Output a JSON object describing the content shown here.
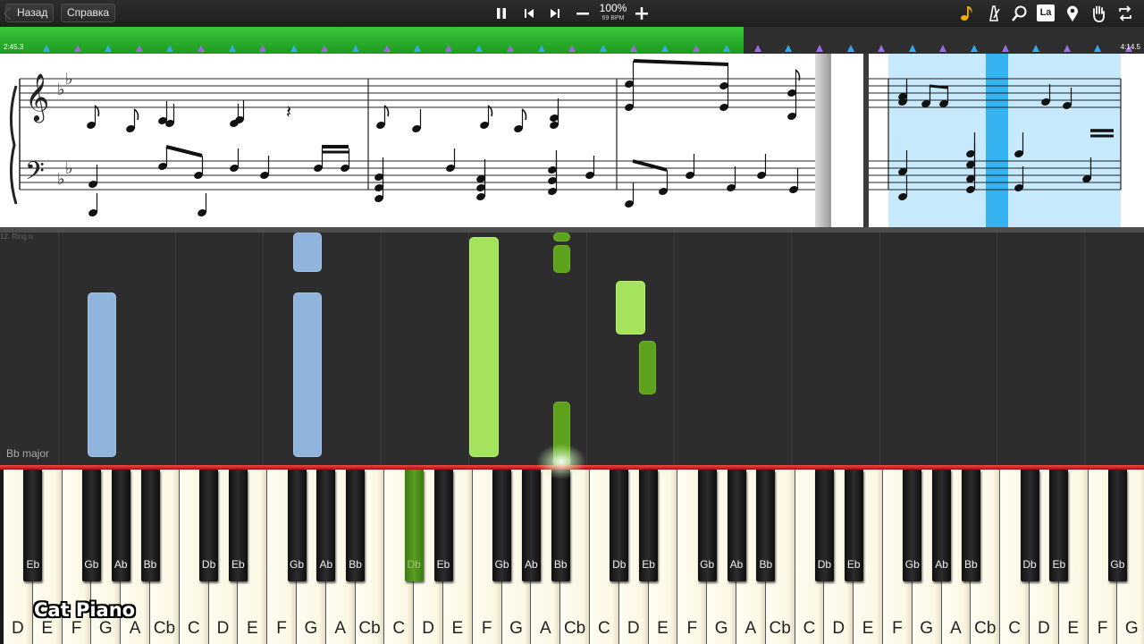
{
  "toolbar": {
    "back_label": "Назад",
    "help_label": "Справка",
    "zoom": "100%",
    "bpm": "69 BPM",
    "la_label": "La",
    "icons": [
      "pause-icon",
      "previous-icon",
      "next-icon",
      "minus-icon",
      "plus-icon",
      "note-icon",
      "metronome-icon",
      "magnifier-icon",
      "la-label",
      "location-pin-icon",
      "hand-icon",
      "loop-icon"
    ]
  },
  "timeline": {
    "current_time": "2:45.3",
    "total_time": "4:14.5",
    "progress": 0.65
  },
  "roll": {
    "key_signature": "Bb major",
    "top_label": "12. Ring n"
  },
  "keyboard": {
    "white_keys": [
      "D",
      "E",
      "F",
      "G",
      "A",
      "Cb",
      "C",
      "D",
      "E",
      "F",
      "G",
      "A",
      "Cb",
      "C",
      "D",
      "E",
      "F",
      "G",
      "A",
      "Cb",
      "C",
      "D",
      "E",
      "F",
      "G",
      "A",
      "Cb",
      "C",
      "D",
      "E",
      "F",
      "G",
      "A",
      "Cb",
      "C",
      "D",
      "E",
      "F",
      "G"
    ],
    "black_keys": [
      "Eb",
      "Gb",
      "Ab",
      "Bb",
      "Db",
      "Eb",
      "Gb",
      "Ab",
      "Bb",
      "Db",
      "Eb",
      "Gb",
      "Ab",
      "Bb",
      "Db",
      "Eb",
      "Gb",
      "Ab",
      "Bb",
      "Db",
      "Eb",
      "Gb",
      "Ab",
      "Bb",
      "Db",
      "Eb",
      "Gb"
    ],
    "pressed_key": "Bb"
  },
  "watermark": "Cat Piano",
  "colors": {
    "progress_green": "#2fb52f",
    "note_blue": "#8fb5dc",
    "note_light_green": "#a6e35c",
    "note_dark_green": "#5ea21c",
    "playhead_red": "#e02a2a",
    "highlight_blue": "#35b3f1"
  }
}
